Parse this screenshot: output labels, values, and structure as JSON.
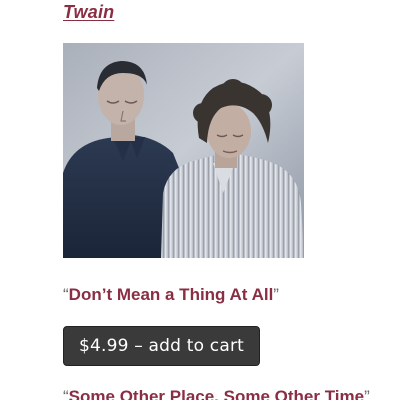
{
  "author": {
    "link_text": "Twain"
  },
  "product": {
    "image_alt": "Photo of a man and a woman looking down",
    "open_quote": "“",
    "title": "Don’t Mean a Thing At All",
    "close_quote": "”",
    "button_label": "$4.99 – add to cart"
  },
  "next_product": {
    "open_quote": "“",
    "title": "Some Other Place, Some Other Time",
    "close_quote": "”"
  },
  "colors": {
    "link": "#8a2e44",
    "button_bg": "#3a3a3a",
    "button_text": "#ffffff"
  }
}
